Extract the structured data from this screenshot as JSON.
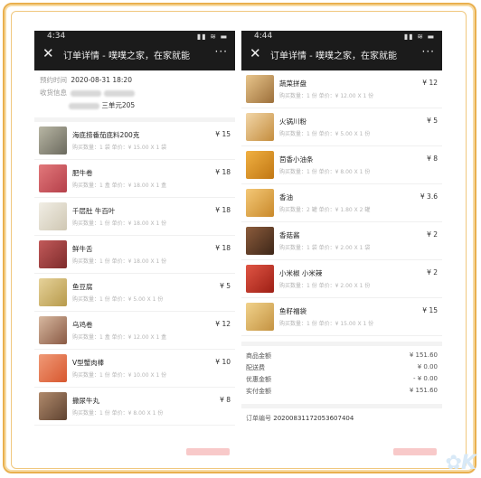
{
  "left_phone": {
    "status_time": "4:34",
    "status_icons": "▮▮ ≋ ▬",
    "title": "订单详情 - 噗噗之家，在家就能",
    "close_icon": "close-icon",
    "more_icon": "more-icon",
    "reserve_label": "预约时间",
    "reserve_time": "2020-08-31 18:20",
    "address_label": "收货信息",
    "address_tail": "三单元205",
    "items": [
      {
        "name": "海底捞番茄底料200克",
        "detail": "购买数量：1 袋  单价：¥ 15.00 X 1 袋",
        "price": "¥ 15"
      },
      {
        "name": "肥牛卷",
        "detail": "购买数量：1 盒  单价：¥ 18.00 X 1 盒",
        "price": "¥ 18"
      },
      {
        "name": "千层肚 牛百叶",
        "detail": "购买数量：1 份  单价：¥ 18.00 X 1 份",
        "price": "¥ 18"
      },
      {
        "name": "鲜牛舌",
        "detail": "购买数量：1 份  单价：¥ 18.00 X 1 份",
        "price": "¥ 18"
      },
      {
        "name": "鱼豆腐",
        "detail": "购买数量：1 份  单价：¥ 5.00 X 1 份",
        "price": "¥ 5"
      },
      {
        "name": "乌鸡卷",
        "detail": "购买数量：1 盒  单价：¥ 12.00 X 1 盒",
        "price": "¥ 12"
      },
      {
        "name": "V型蟹肉棒",
        "detail": "购买数量：1 份  单价：¥ 10.00 X 1 份",
        "price": "¥ 10"
      },
      {
        "name": "撒尿牛丸",
        "detail": "购买数量：1 份  单价：¥ 8.00 X 1 份",
        "price": "¥ 8"
      }
    ]
  },
  "right_phone": {
    "status_time": "4:44",
    "status_icons": "▮▮ ≋ ▬",
    "title": "订单详情 - 噗噗之家，在家就能",
    "close_icon": "close-icon",
    "more_icon": "more-icon",
    "items": [
      {
        "name": "蔬菜拼盘",
        "detail": "购买数量：1 份  单价：¥ 12.00 X 1 份",
        "price": "¥ 12"
      },
      {
        "name": "火锅川粉",
        "detail": "购买数量：1 份  单价：¥ 5.00 X 1 份",
        "price": "¥ 5"
      },
      {
        "name": "茴香小油条",
        "detail": "购买数量：1 份  单价：¥ 8.00 X 1 份",
        "price": "¥ 8"
      },
      {
        "name": "香油",
        "detail": "购买数量：2 罐  单价：¥ 1.80 X 2 罐",
        "price": "¥ 3.6"
      },
      {
        "name": "香菇酱",
        "detail": "购买数量：1 袋  单价：¥ 2.00 X 1 袋",
        "price": "¥ 2"
      },
      {
        "name": "小米椒 小米辣",
        "detail": "购买数量：1 份  单价：¥ 2.00 X 1 份",
        "price": "¥ 2"
      },
      {
        "name": "鱼籽福袋",
        "detail": "购买数量：1 份  单价：¥ 15.00 X 1 份",
        "price": "¥ 15"
      }
    ],
    "summary": {
      "goods_label": "商品金额",
      "goods_value": "¥ 151.60",
      "delivery_label": "配送费",
      "delivery_value": "¥ 0.00",
      "discount_label": "优惠金额",
      "discount_value": "- ¥ 0.00",
      "paid_label": "实付金额",
      "paid_value": "¥ 151.60"
    },
    "order_label": "订单编号",
    "order_no": "20200831172053607404"
  },
  "colors": {
    "frame": "#e9b04f",
    "topbar": "#1b1b1b",
    "pink_button": "#f8c9c9"
  }
}
